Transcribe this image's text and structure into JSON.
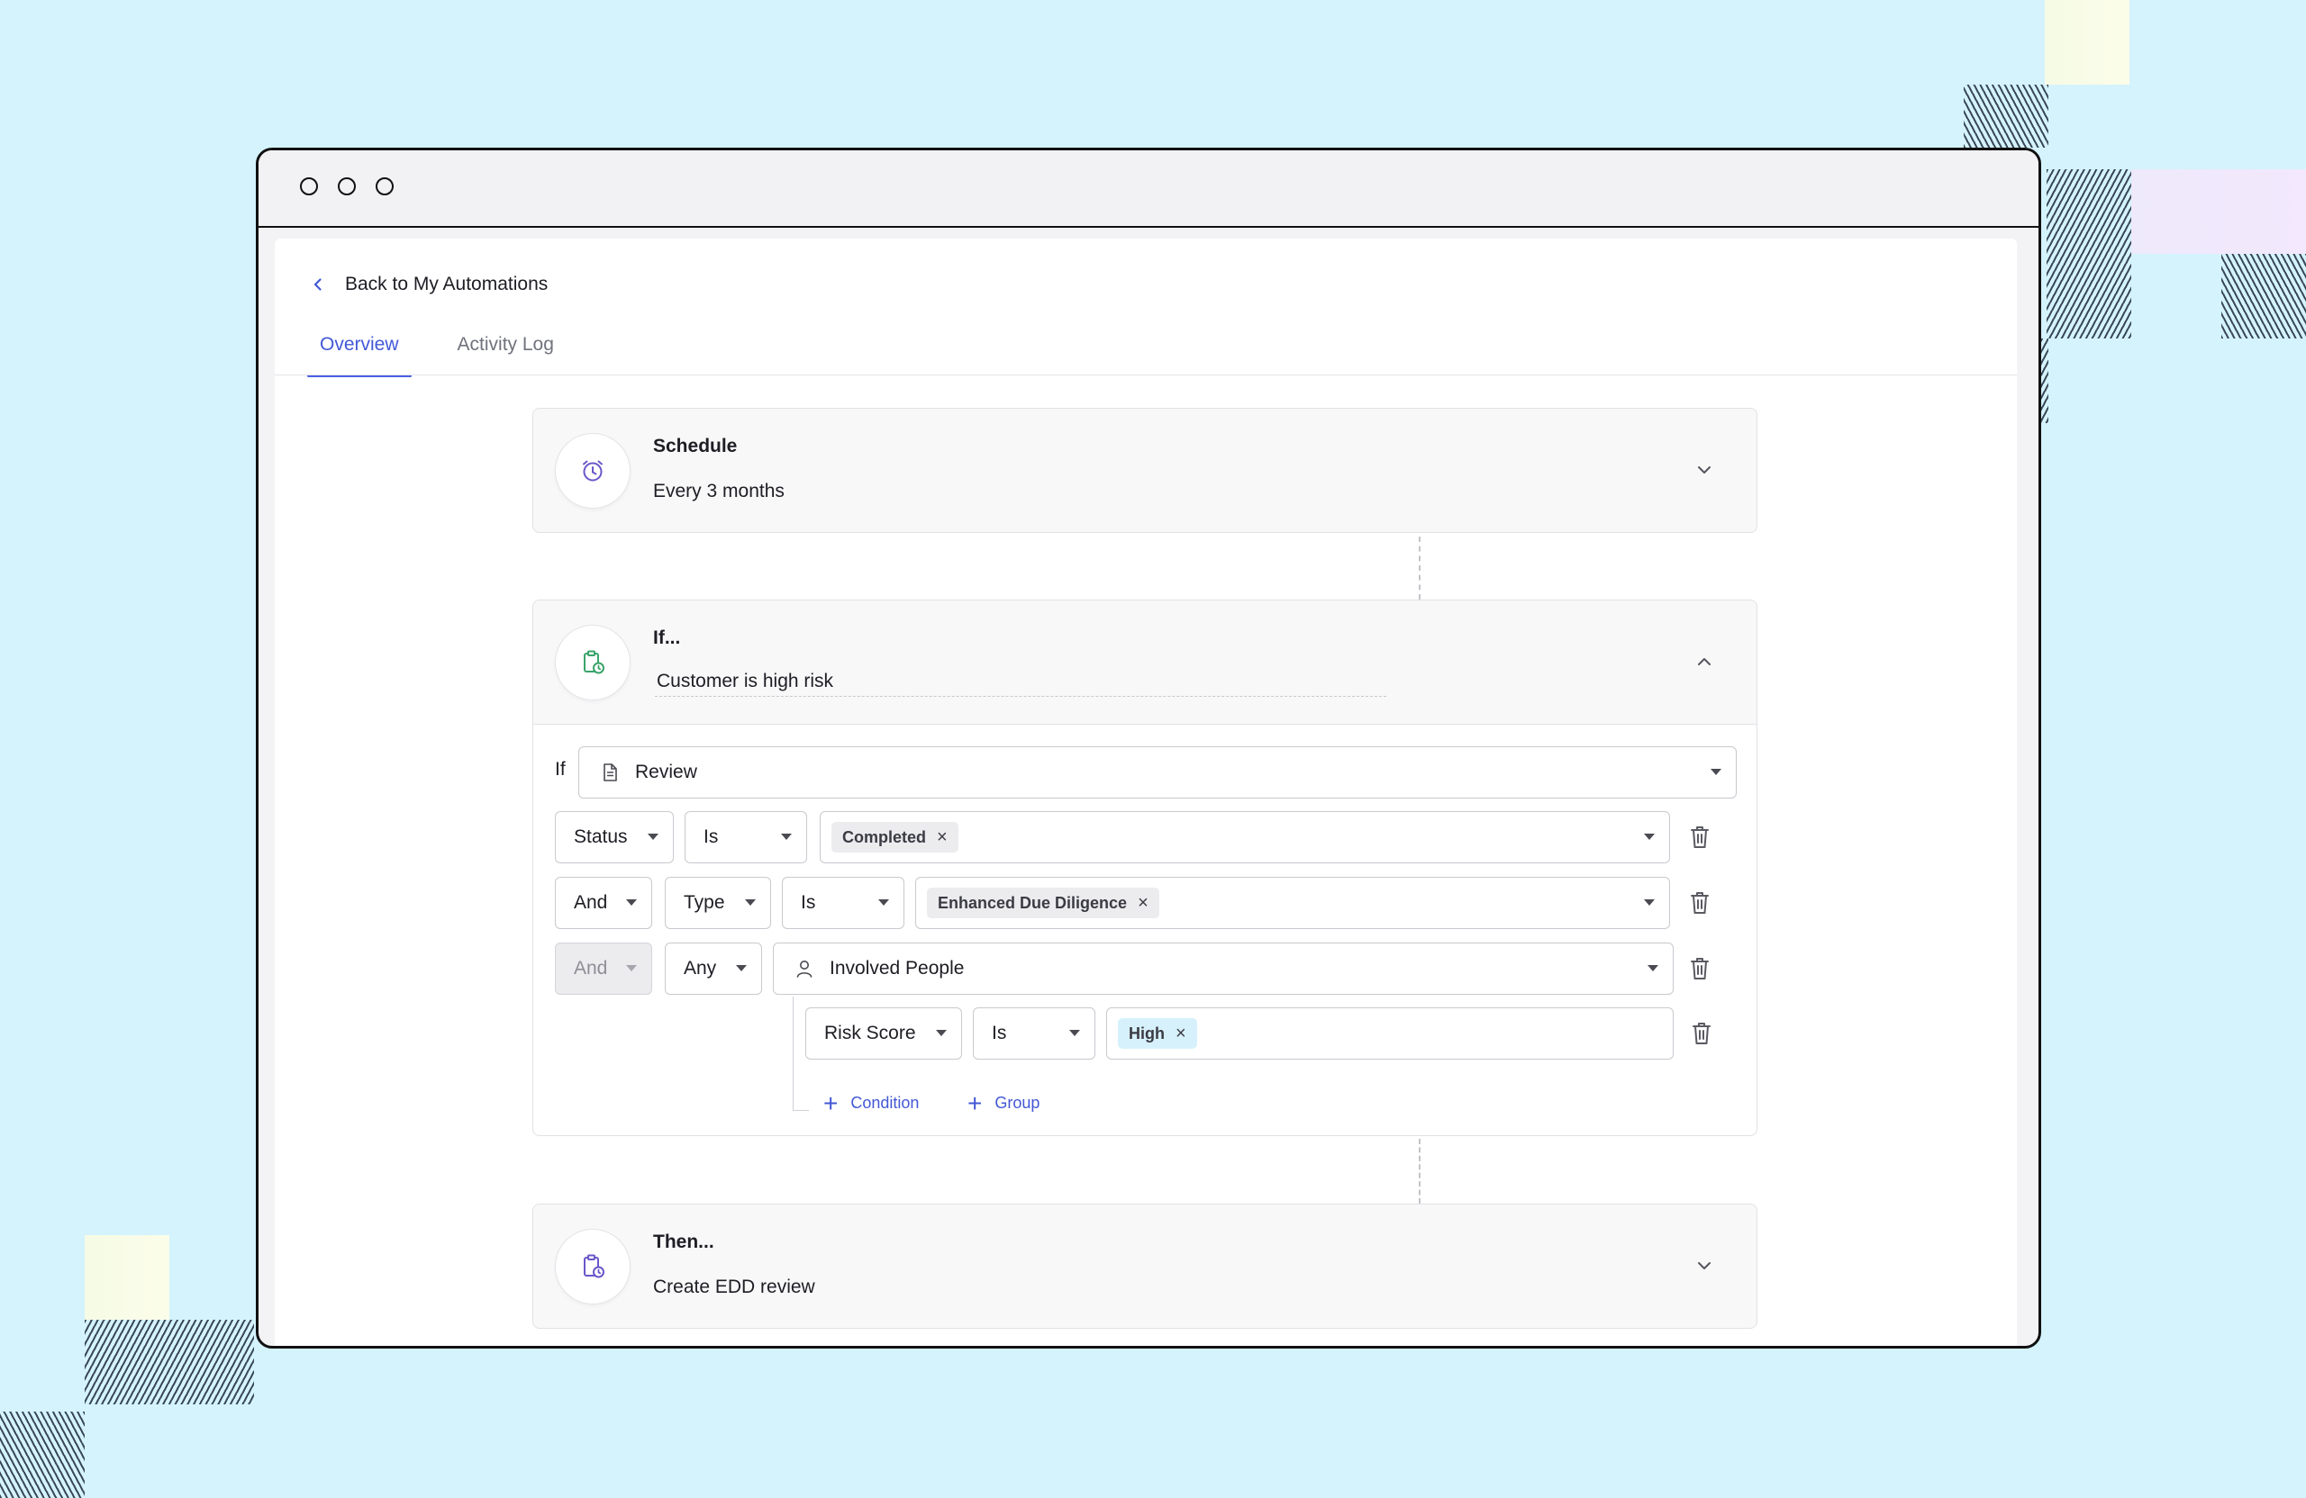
{
  "nav": {
    "back_label": "Back to My Automations"
  },
  "tabs": [
    {
      "label": "Overview",
      "active": true
    },
    {
      "label": "Activity Log",
      "active": false
    }
  ],
  "schedule": {
    "title": "Schedule",
    "value": "Every 3 months",
    "icon": "alarm-clock-icon"
  },
  "condition": {
    "title": "If...",
    "summary": "Customer is high risk",
    "icon": "clipboard-clock-icon",
    "if_label": "If",
    "entity": "Review",
    "rows": [
      {
        "field": "Status",
        "operator": "Is",
        "values": [
          "Completed"
        ]
      },
      {
        "conjunction": "And",
        "field": "Type",
        "operator": "Is",
        "values": [
          "Enhanced Due Diligence"
        ]
      },
      {
        "conjunction": "And",
        "quantifier": "Any",
        "relation": "Involved People"
      },
      {
        "field": "Risk Score",
        "operator": "Is",
        "values": [
          "High"
        ]
      }
    ],
    "add_condition_label": "Condition",
    "add_group_label": "Group"
  },
  "action": {
    "title": "Then...",
    "value": "Create EDD review",
    "icon": "clipboard-clock-icon"
  },
  "colors": {
    "accent": "#4358d6",
    "background": "#d4f3fd",
    "chip_blue": "#d6f1fb"
  }
}
